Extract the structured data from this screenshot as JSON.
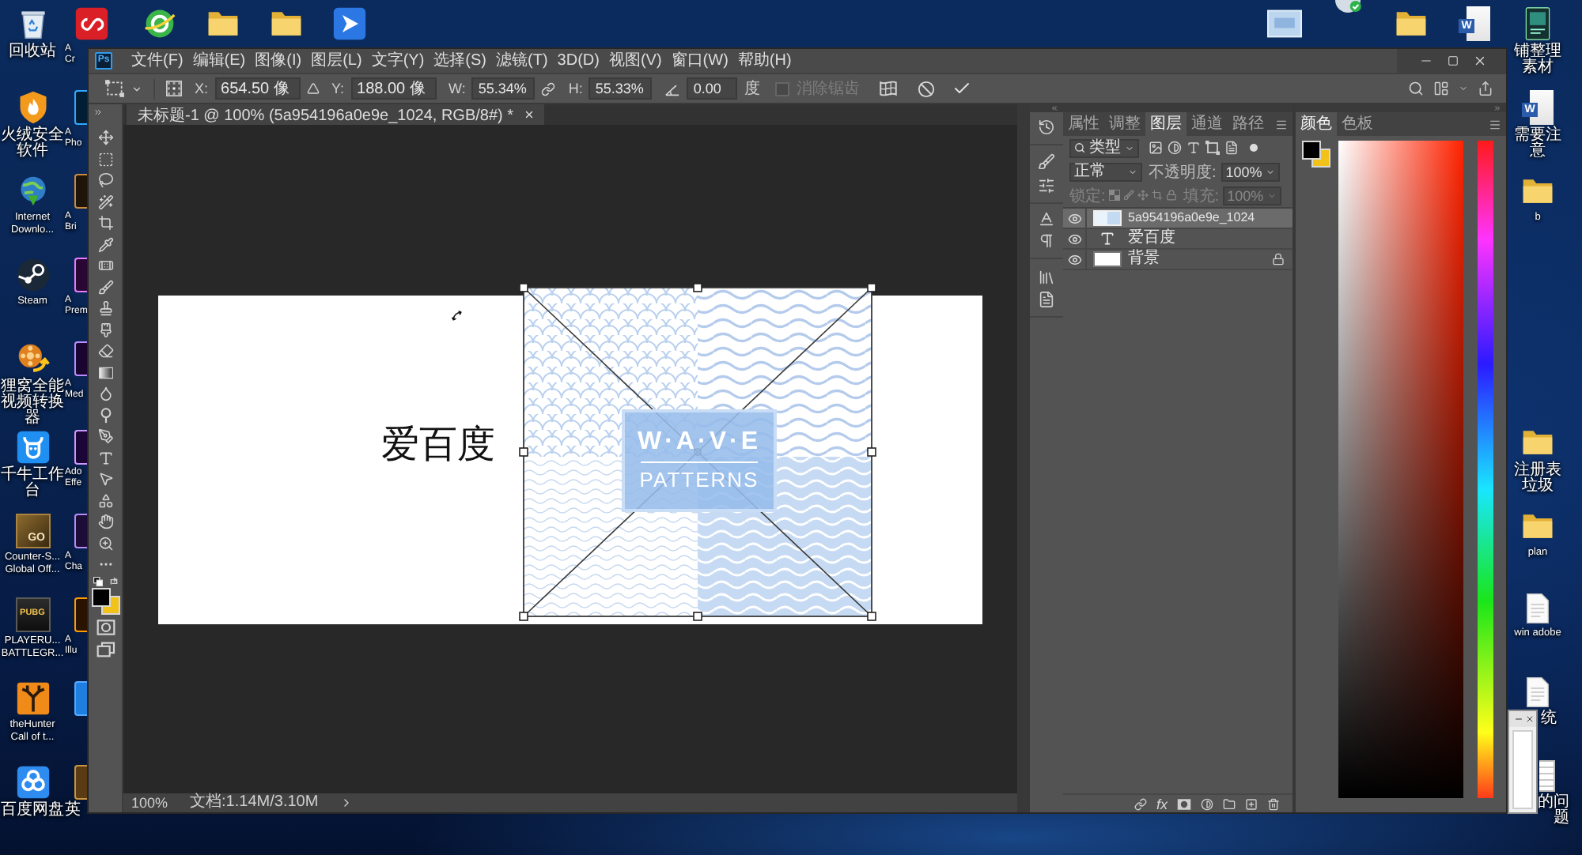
{
  "desktop": {
    "left_icons": [
      {
        "kind": "recycle",
        "label": "回收站"
      },
      {
        "kind": "shield",
        "label": "火绒安全软件"
      },
      {
        "kind": "globe",
        "label": "Internet\nDownlo..."
      },
      {
        "kind": "steam",
        "label": "Steam"
      },
      {
        "kind": "reel",
        "label": "狸窝全能视频转换器"
      },
      {
        "kind": "bull",
        "label": "千牛工作台"
      },
      {
        "kind": "shooter",
        "label": "Counter-S...\nGlobal Off...",
        "badge": "GO"
      },
      {
        "kind": "battle",
        "label": "PLAYERU...\nBATTLEGR...",
        "badge": "PUBG"
      },
      {
        "kind": "antler",
        "label": "theHunter\nCall of t..."
      },
      {
        "kind": "cloud",
        "label": "百度网盘"
      }
    ],
    "second_column": [
      {
        "kind": "creative",
        "label": "A\nCr"
      },
      {
        "kind": "photoshop",
        "label": "A\nPho"
      },
      {
        "kind": "bridge",
        "label": "A\nBri"
      },
      {
        "kind": "premiere",
        "label": "A\nPrem"
      },
      {
        "kind": "encoder",
        "label": "A\nMed"
      },
      {
        "kind": "aftereffects",
        "label": "Ado\nEffe"
      },
      {
        "kind": "character",
        "label": "A\nCha"
      },
      {
        "kind": "illustrator",
        "label": "A\nIllu"
      },
      {
        "kind": "blue"
      },
      {
        "kind": "game",
        "label": "英"
      }
    ],
    "right_icons": [
      {
        "kind": "thumbnail"
      },
      {
        "kind": "sync"
      },
      {
        "kind": "folder"
      },
      {
        "kind": "word",
        "badge": "W"
      },
      {
        "kind": "book",
        "label": "铺整理素材"
      },
      {
        "kind": "word",
        "badge": "W",
        "label": "需要注意"
      },
      {
        "kind": "folder",
        "label": "b"
      },
      {
        "kind": "folder",
        "label": "注册表垃圾"
      },
      {
        "kind": "folder",
        "label": "plan"
      },
      {
        "kind": "doc",
        "label": "win adobe"
      },
      {
        "kind": "doc",
        "label": "统"
      },
      {
        "kind": "doc",
        "label": "的问题"
      }
    ]
  },
  "editor": {
    "logo": "Ps",
    "menu": [
      "文件(F)",
      "编辑(E)",
      "图像(I)",
      "图层(L)",
      "文字(Y)",
      "选择(S)",
      "滤镜(T)",
      "3D(D)",
      "视图(V)",
      "窗口(W)",
      "帮助(H)"
    ],
    "options_bar": {
      "position_fields": [
        {
          "label": "X:",
          "value": "654.50 像"
        },
        {
          "label": "Y:",
          "value": "188.00 像"
        }
      ],
      "size_fields": [
        {
          "label": "W:",
          "value": "55.34%"
        },
        {
          "label": "H:",
          "value": "55.33%"
        }
      ],
      "angle": {
        "value": "0.00",
        "unit": "度"
      },
      "option": {
        "label": "消除锯齿",
        "checked": false,
        "disabled": true
      }
    },
    "document_tab": {
      "title": "未标题-1 @ 100% (5a954196a0e9e_1024, RGB/8#) *"
    },
    "canvas": {
      "text_layer": "爱百度",
      "image_title": "W·A·V·E",
      "image_subtitle": "PATTERNS"
    },
    "status_bar": {
      "zoom": "100%",
      "document_size": "文档:1.14M/3.10M"
    },
    "layers_panel": {
      "tabs": [
        {
          "label": "属性",
          "selected": false
        },
        {
          "label": "调整",
          "selected": false
        },
        {
          "label": "图层",
          "selected": true
        },
        {
          "label": "通道",
          "selected": false
        },
        {
          "label": "路径",
          "selected": false
        }
      ],
      "filter": "类型",
      "blend_mode": "正常",
      "opacity": {
        "label": "不透明度:",
        "value": "100%"
      },
      "lock": {
        "label": "锁定:",
        "disabled": true
      },
      "fill": {
        "label": "填充:",
        "value": "100%",
        "disabled": true
      },
      "layers": [
        {
          "kind": "smart",
          "name": "5a954196a0e9e_1024",
          "selected": true,
          "visible": true
        },
        {
          "kind": "text",
          "name": "爱百度",
          "selected": false,
          "visible": true
        },
        {
          "kind": "background",
          "name": "背景",
          "selected": false,
          "visible": true
        }
      ],
      "effects_button": "fx"
    },
    "color_panel": {
      "tabs": [
        {
          "label": "颜色",
          "selected": true
        },
        {
          "label": "色板",
          "selected": false
        }
      ]
    }
  }
}
